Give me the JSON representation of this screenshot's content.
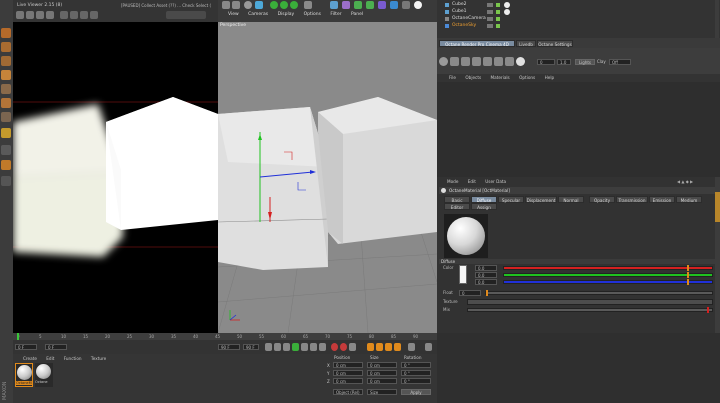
{
  "app": {
    "title": "Live Viewer 2.15 (8)"
  },
  "live_viewer": {
    "title": "Live Viewer 2.15 (8)",
    "info": "[PAUSED] Collect Asset (??) ... Check Select ("
  },
  "viewport": {
    "menu": [
      "View",
      "Cameras",
      "Display",
      "Options",
      "Filter",
      "Panel"
    ],
    "label": "Perspective"
  },
  "objects": {
    "items": [
      {
        "name": "Cube2",
        "color": "#d0d0d0"
      },
      {
        "name": "Cube1",
        "color": "#d0d0d0"
      },
      {
        "name": "OctaneCamera",
        "color": "#d0d0d0"
      },
      {
        "name": "OctaneSky",
        "color": "#f0a030"
      }
    ]
  },
  "toolbar_right": {
    "tabs": [
      "Octane Render Pro Cinema 4D 2.15 (8)",
      "Livedb",
      "Octane Settings"
    ],
    "field1": "0",
    "field2": "1.0",
    "btn_label": "Lights",
    "clay_label": "Clay",
    "clay_value": "Off"
  },
  "material_browser": {
    "menu": [
      "File",
      "Objects",
      "Materials",
      "Options",
      "Help"
    ]
  },
  "attributes": {
    "menu": [
      "Mode",
      "Edit",
      "User Data"
    ],
    "name": "OctaneMaterial [OctMaterial]",
    "tabs_row1": [
      "Basic",
      "Diffuse",
      "Specular",
      "Displacement",
      "Normal",
      "Opacity",
      "Transmission",
      "Emission",
      "Medium"
    ],
    "tabs_row2": [
      "Editor",
      "Assign"
    ],
    "section": "Diffuse",
    "color_label": "Color",
    "color_values": [
      "0.0",
      "0.0",
      "0.0"
    ],
    "float_label": "Float",
    "float_value": "0",
    "texture_label": "Texture",
    "mix_label": "Mix"
  },
  "timeline": {
    "ticks": [
      "0",
      "5",
      "10",
      "15",
      "20",
      "25",
      "30",
      "35",
      "40",
      "45",
      "50",
      "55",
      "60",
      "65",
      "70",
      "75",
      "80",
      "85",
      "90"
    ],
    "start_frame": "0 F",
    "current": "0 F",
    "end_frame": "90 F",
    "end2": "90 F",
    "frame_readout": "0 F"
  },
  "material_manager": {
    "menu": [
      "Create",
      "Edit",
      "Function",
      "Texture"
    ],
    "materials": [
      "OctaneM",
      "Octane"
    ]
  },
  "coords": {
    "headers": [
      "Position",
      "Size",
      "Rotation"
    ],
    "rows": [
      {
        "axis": "X",
        "pos": "0 cm",
        "size": "0 cm",
        "rot": "0 °"
      },
      {
        "axis": "Y",
        "pos": "0 cm",
        "size": "0 cm",
        "rot": "0 °"
      },
      {
        "axis": "Z",
        "pos": "0 cm",
        "size": "0 cm",
        "rot": "0 °"
      }
    ],
    "dropdown1": "Object (Rel)",
    "dropdown2": "Size",
    "apply": "Apply"
  },
  "colors": {
    "red": "#d42020",
    "green": "#1fc21f",
    "blue": "#2030d8",
    "accent_tab": "#7a8ca0",
    "orange": "#e08a1c"
  }
}
